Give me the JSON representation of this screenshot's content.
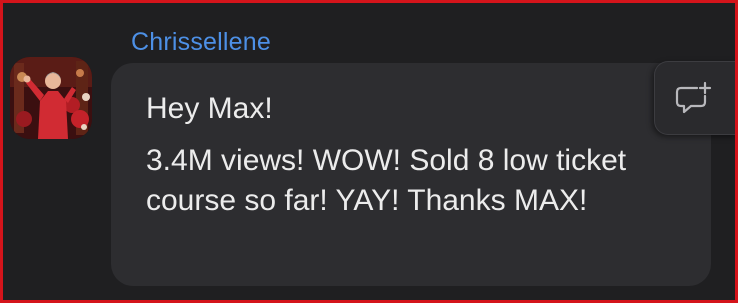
{
  "message": {
    "sender": "Chrissellene",
    "greeting": "Hey Max!",
    "body": "3.4M views! WOW! Sold 8 low ticket course so far! YAY! Thanks MAX!"
  },
  "actions": {
    "reply_icon": "comment-plus-icon"
  },
  "colors": {
    "background": "#1f1f21",
    "bubble": "#2d2d30",
    "sender_name": "#4d90e6",
    "text": "#ececec",
    "frame": "#d4141b"
  }
}
